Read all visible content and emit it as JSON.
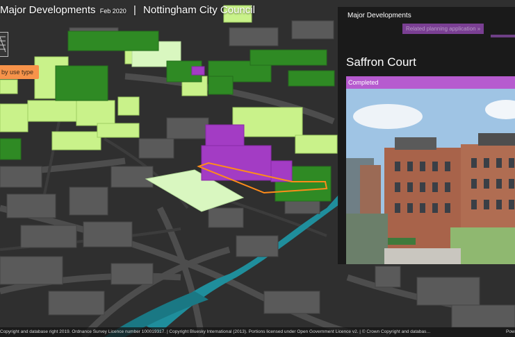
{
  "header": {
    "app_title": "Major Developments",
    "date": "Feb 2020",
    "separator": "|",
    "council": "Nottingham City Council"
  },
  "controls": {
    "use_type_button": "by use type",
    "layer_icon": "layers-icon"
  },
  "panel": {
    "title": "Major Developments",
    "related_button": "Related planning application »",
    "development_name": "Saffron Court",
    "status": "Completed"
  },
  "footer": {
    "attribution": "Copyright and database right 2019. Ordnance Survey Licence number 100019317. | Copyright Bluesky International (2013). Portions licensed under Open Government Licence v2. | © Crown Copyright and databas…",
    "powered": "Pow"
  },
  "colors": {
    "panel_bg": "#191919",
    "status_purple": "#b65bcf",
    "button_orange": "#f7934a",
    "building_light_green": "#c9f28a",
    "building_green": "#2f8a24",
    "building_purple": "#a33cc4",
    "river_teal": "#1f8e9c"
  }
}
